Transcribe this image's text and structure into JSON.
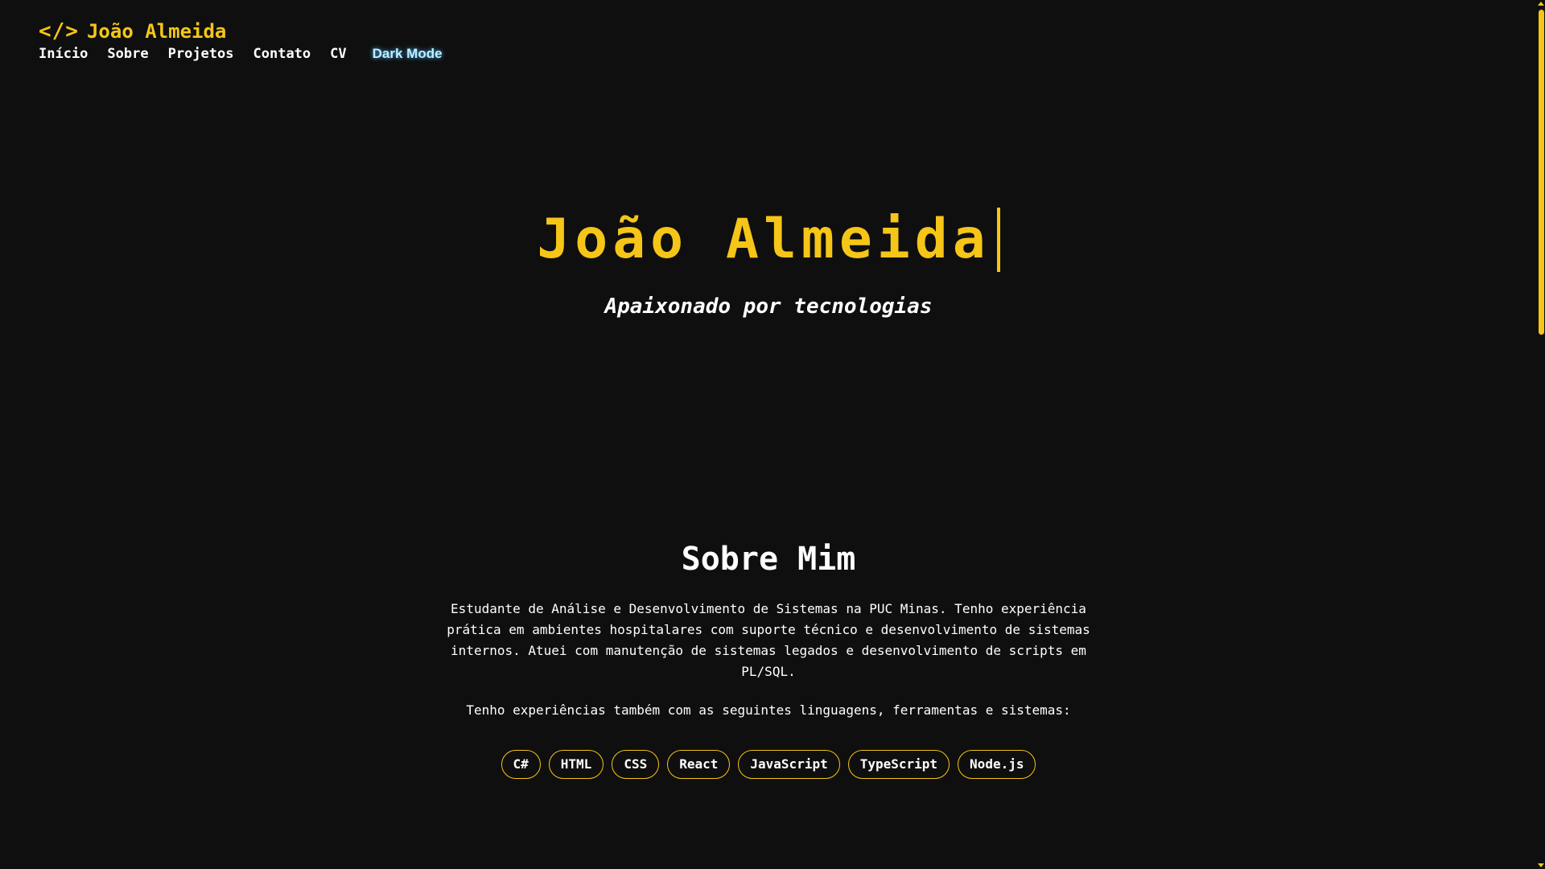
{
  "brand": {
    "icon": "code-icon",
    "icon_glyph": "</>",
    "name": "João Almeida"
  },
  "nav": {
    "items": [
      {
        "label": "Início"
      },
      {
        "label": "Sobre"
      },
      {
        "label": "Projetos"
      },
      {
        "label": "Contato"
      },
      {
        "label": "CV"
      }
    ],
    "theme_toggle": "Dark Mode"
  },
  "hero": {
    "title": "João Almeida",
    "subtitle": "Apaixonado por tecnologias"
  },
  "about": {
    "heading": "Sobre Mim",
    "paragraph1": "Estudante de Análise e Desenvolvimento de Sistemas na PUC Minas. Tenho experiência prática em ambientes hospitalares com suporte técnico e desenvolvimento de sistemas internos. Atuei com manutenção de sistemas legados e desenvolvimento de scripts em PL/SQL.",
    "paragraph2": "Tenho experiências também com as seguintes linguagens, ferramentas e sistemas:",
    "skills": [
      "C#",
      "HTML",
      "CSS",
      "React",
      "JavaScript",
      "TypeScript",
      "Node.js"
    ]
  },
  "colors": {
    "background": "#0f0f0f",
    "accent": "#f5c518",
    "text": "#ffffff",
    "toggle": "#bfeeff"
  }
}
